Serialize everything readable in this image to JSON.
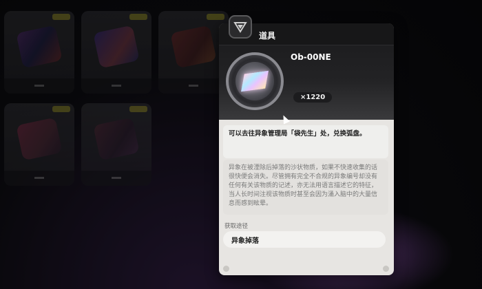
{
  "panel": {
    "title": "道具",
    "item_name": "Ob-00NE",
    "count": "×1220",
    "usage": "可以去往异象管理局「袋先生」处，兑换弧盘。",
    "description": "异象在被湮除后掉落的沙状物质，如果不快速收集的话很快便会消失。尽管拥有完全不合规的异象编号却没有任何有关该物质的记述，亦无法用语言描述它的特征，当人长时间注视该物质时甚至会因为涌入脑中的大量信息而感到眩晕。",
    "source_label": "获取途径",
    "source_value": "异象掉落",
    "icon": "item-category-badge-icon",
    "item_image": "prism-crystal-icon"
  },
  "colors": {
    "panel_bg": "#e7e5e2",
    "header_bg": "#171718",
    "tag_yellow": "#c9c23a"
  }
}
